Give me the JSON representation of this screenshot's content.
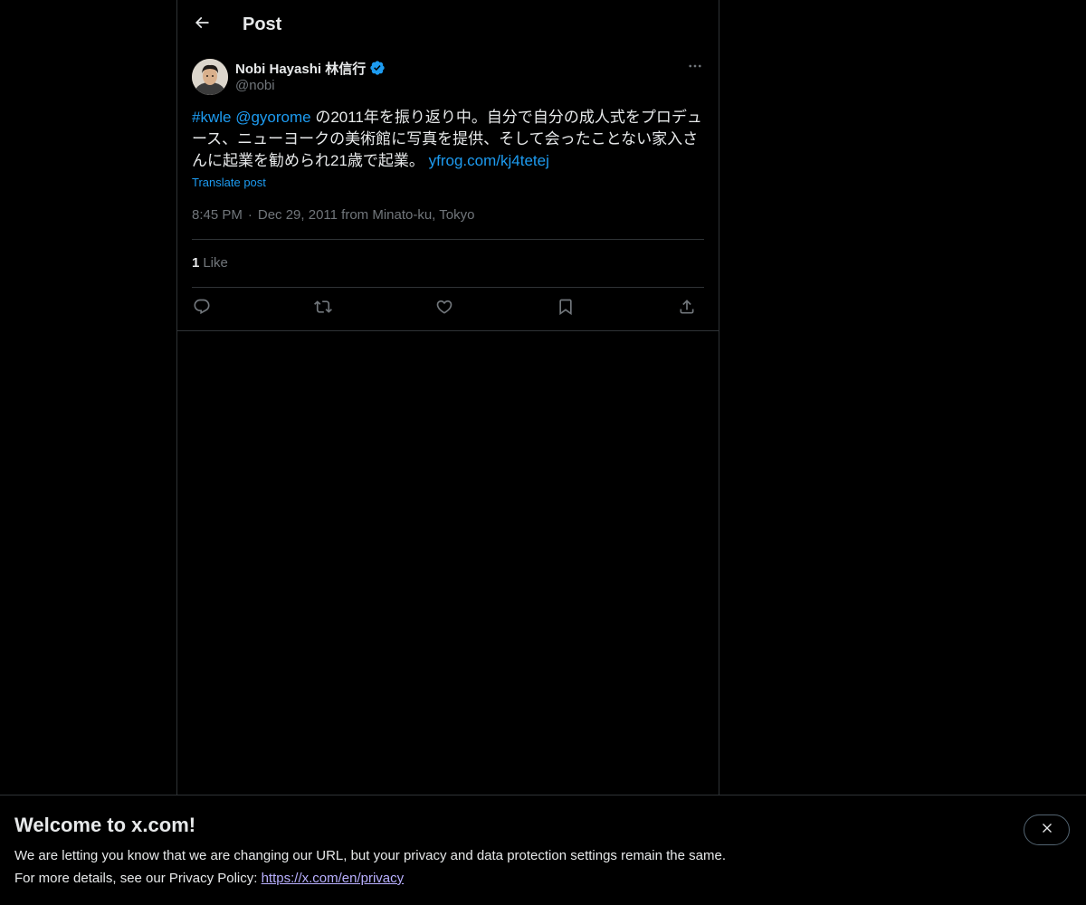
{
  "header": {
    "title": "Post",
    "back_icon": "arrow-left-icon"
  },
  "post": {
    "author": {
      "name": "Nobi Hayashi 林信行",
      "handle": "@nobi",
      "verified_icon": "verified-badge-icon",
      "verified_color": "#1d9bf0"
    },
    "more_icon": "more-dots-icon",
    "text": {
      "hashtag": "#kwle",
      "mention": "@gyorome",
      "body": " の2011年を振り返り中。自分で自分の成人式をプロデュース、ニューヨークの美術館に写真を提供、そして会ったことない家入さんに起業を勧められ21歳で起業。 ",
      "url": "yfrog.com/kj4tetej"
    },
    "translate_label": "Translate post",
    "time": "8:45 PM",
    "separator": "·",
    "date_location": "Dec 29, 2011 from Minato-ku, Tokyo",
    "likes_count": "1",
    "likes_label": "Like",
    "actions": [
      {
        "name": "reply",
        "icon": "reply-icon"
      },
      {
        "name": "repost",
        "icon": "repost-icon"
      },
      {
        "name": "like",
        "icon": "heart-icon"
      },
      {
        "name": "bookmark",
        "icon": "bookmark-icon"
      },
      {
        "name": "share",
        "icon": "share-icon"
      }
    ]
  },
  "banner": {
    "title": "Welcome to x.com!",
    "line1": "We are letting you know that we are changing our URL, but your privacy and data protection settings remain the same.",
    "line2_prefix": "For more details, see our Privacy Policy: ",
    "privacy_url": "https://x.com/en/privacy",
    "close_icon": "close-icon"
  },
  "colors": {
    "background": "#000000",
    "text": "#e7e9ea",
    "secondary": "#71767b",
    "accent": "#1d9bf0",
    "border": "#2f3336"
  }
}
